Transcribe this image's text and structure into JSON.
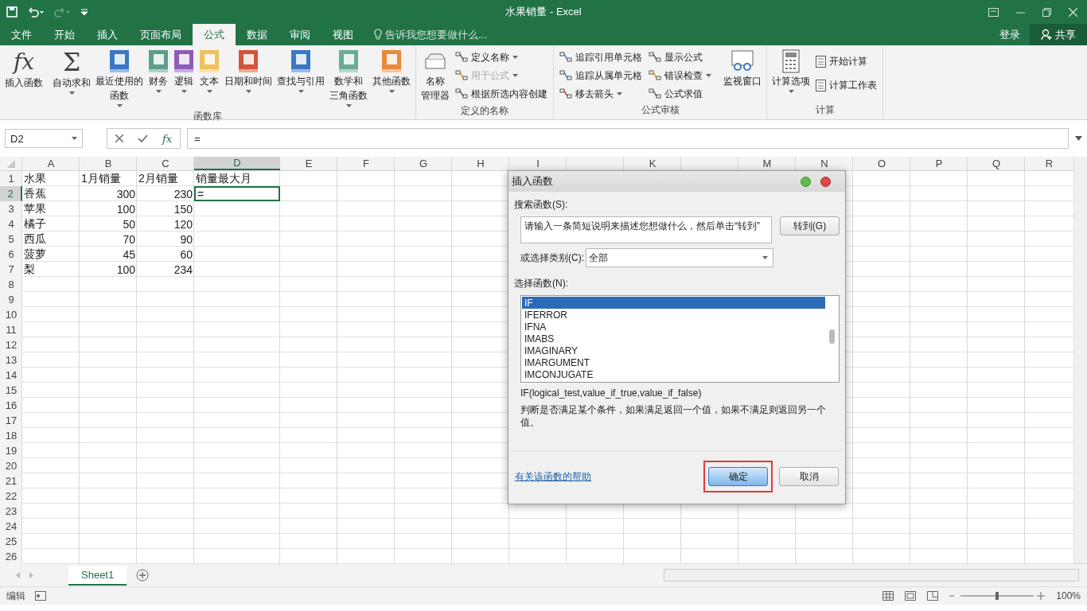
{
  "window": {
    "title": "水果销量 - Excel"
  },
  "ribbon_tabs": [
    {
      "label": "文件",
      "selected": false
    },
    {
      "label": "开始",
      "selected": false
    },
    {
      "label": "插入",
      "selected": false
    },
    {
      "label": "页面布局",
      "selected": false
    },
    {
      "label": "公式",
      "selected": true
    },
    {
      "label": "数据",
      "selected": false
    },
    {
      "label": "审阅",
      "selected": false
    },
    {
      "label": "视图",
      "selected": false
    }
  ],
  "tell_me": {
    "placeholder": "告诉我您想要做什么..."
  },
  "account": {
    "sign_in": "登录",
    "share": "共享"
  },
  "function_library": {
    "label": "函数库",
    "buttons": [
      {
        "kind": "glyph",
        "glyph": "fx",
        "lines": [
          "插入函数"
        ],
        "dropdown": false
      },
      {
        "kind": "glyph",
        "glyph": "Σ",
        "lines": [
          "自动求和"
        ],
        "dropdown": true
      },
      {
        "kind": "book",
        "color": "#3b78c4",
        "lines": [
          "最近使用的",
          "函数"
        ],
        "dropdown": true
      },
      {
        "kind": "book",
        "color": "#5e9e8b",
        "lines": [
          "财务"
        ],
        "dropdown": true
      },
      {
        "kind": "book",
        "color": "#8d5cb8",
        "lines": [
          "逻辑"
        ],
        "dropdown": true
      },
      {
        "kind": "book",
        "color": "#eec15e",
        "lines": [
          "文本"
        ],
        "dropdown": true
      },
      {
        "kind": "book",
        "color": "#d3553a",
        "lines": [
          "日期和时间"
        ],
        "dropdown": true
      },
      {
        "kind": "book",
        "color": "#3b78c4",
        "lines": [
          "查找与引用"
        ],
        "dropdown": true
      },
      {
        "kind": "book",
        "color": "#6aab98",
        "lines": [
          "数学和",
          "三角函数"
        ],
        "dropdown": true
      },
      {
        "kind": "book",
        "color": "#e88a3a",
        "lines": [
          "其他函数"
        ],
        "dropdown": true
      }
    ]
  },
  "defined_names": {
    "label": "定义的名称",
    "big": {
      "lines": [
        "名称",
        "管理器"
      ]
    },
    "items": [
      {
        "label": "定义名称",
        "dropdown": true,
        "disabled": false
      },
      {
        "label": "用于公式",
        "dropdown": true,
        "disabled": true
      },
      {
        "label": "根据所选内容创建",
        "dropdown": false,
        "disabled": false
      }
    ]
  },
  "formula_auditing": {
    "label": "公式审核",
    "items": [
      {
        "label": "追踪引用单元格",
        "dropdown": false
      },
      {
        "label": "追踪从属单元格",
        "dropdown": false
      },
      {
        "label": "移去箭头",
        "dropdown": true
      },
      {
        "label": "显示公式",
        "dropdown": false
      },
      {
        "label": "错误检查",
        "dropdown": true
      },
      {
        "label": "公式求值",
        "dropdown": false
      }
    ],
    "watch": "监视窗口"
  },
  "calculation": {
    "label": "计算",
    "options": "计算选项",
    "items": [
      "开始计算",
      "计算工作表"
    ]
  },
  "formula_bar": {
    "name_box": "D2",
    "fx": "fx",
    "value": "="
  },
  "table": {
    "columns": [
      {
        "label": "A",
        "selected": false,
        "kind": "text"
      },
      {
        "label": "B",
        "selected": false,
        "kind": "number"
      },
      {
        "label": "C",
        "selected": false,
        "kind": "number"
      },
      {
        "label": "D",
        "selected": true,
        "kind": "text"
      },
      {
        "label": "E",
        "selected": false,
        "kind": "text"
      },
      {
        "label": "F",
        "selected": false,
        "kind": "text"
      },
      {
        "label": "G",
        "selected": false,
        "kind": "text"
      },
      {
        "label": "H",
        "selected": false,
        "kind": "text"
      },
      {
        "label": "I",
        "selected": false,
        "kind": "text"
      },
      {
        "kind": "text"
      },
      {
        "label": "K",
        "selected": false,
        "kind": "text"
      },
      {
        "kind": "text"
      },
      {
        "label": "M",
        "selected": false,
        "kind": "text"
      },
      {
        "label": "N",
        "selected": false,
        "kind": "text"
      },
      {
        "label": "O",
        "selected": false,
        "kind": "text"
      },
      {
        "label": "P",
        "selected": false,
        "kind": "text"
      },
      {
        "label": "Q",
        "selected": false,
        "kind": "text"
      },
      {
        "label": "R",
        "selected": false,
        "kind": "text"
      }
    ],
    "rows": [
      {
        "label": "1",
        "selected": false,
        "kind": "header",
        "cells": [
          "水果",
          "1月销量",
          "2月销量",
          "销量最大月"
        ]
      },
      {
        "label": "2",
        "selected": true,
        "kind": "data",
        "cells": [
          "香蕉",
          "300",
          "230",
          "="
        ]
      },
      {
        "label": "3",
        "selected": false,
        "kind": "data",
        "cells": [
          "苹果",
          "100",
          "150"
        ]
      },
      {
        "label": "4",
        "selected": false,
        "kind": "data",
        "cells": [
          "橘子",
          "50",
          "120"
        ]
      },
      {
        "label": "5",
        "selected": false,
        "kind": "data",
        "cells": [
          "西瓜",
          "70",
          "90"
        ]
      },
      {
        "label": "6",
        "selected": false,
        "kind": "data",
        "cells": [
          "菠萝",
          "45",
          "60"
        ]
      },
      {
        "label": "7",
        "selected": false,
        "kind": "data",
        "cells": [
          "梨",
          "100",
          "234"
        ]
      },
      {
        "label": "8",
        "selected": false,
        "kind": "data",
        "cells": []
      },
      {
        "label": "9",
        "selected": false,
        "kind": "data",
        "cells": []
      },
      {
        "label": "10",
        "selected": false,
        "kind": "data",
        "cells": []
      },
      {
        "label": "11",
        "selected": false,
        "kind": "data",
        "cells": []
      },
      {
        "label": "12",
        "selected": false,
        "kind": "data",
        "cells": []
      },
      {
        "label": "13",
        "selected": false,
        "kind": "data",
        "cells": []
      },
      {
        "label": "14",
        "selected": false,
        "kind": "data",
        "cells": []
      },
      {
        "label": "15",
        "selected": false,
        "kind": "data",
        "cells": []
      },
      {
        "label": "16",
        "selected": false,
        "kind": "data",
        "cells": []
      },
      {
        "label": "17",
        "selected": false,
        "kind": "data",
        "cells": []
      },
      {
        "label": "18",
        "selected": false,
        "kind": "data",
        "cells": []
      },
      {
        "label": "19",
        "selected": false,
        "kind": "data",
        "cells": []
      },
      {
        "label": "20",
        "selected": false,
        "kind": "data",
        "cells": []
      },
      {
        "label": "21",
        "selected": false,
        "kind": "data",
        "cells": []
      },
      {
        "label": "22",
        "selected": false,
        "kind": "data",
        "cells": []
      },
      {
        "label": "23",
        "selected": false,
        "kind": "data",
        "cells": []
      },
      {
        "label": "24",
        "selected": false,
        "kind": "data",
        "cells": []
      },
      {
        "label": "25",
        "selected": false,
        "kind": "data",
        "cells": []
      },
      {
        "label": "26",
        "selected": false,
        "kind": "data",
        "cells": []
      }
    ]
  },
  "dialog": {
    "title": "插入函数",
    "search_label": "搜索函数(S):",
    "search_value": "请输入一条简短说明来描述您想做什么，然后单击“转到”",
    "go_button": "转到(G)",
    "category_label": "或选择类别(C):",
    "category_value": "全部",
    "list_label": "选择函数(N):",
    "functions": [
      {
        "label": "IF",
        "selected": true
      },
      {
        "label": "IFERROR",
        "selected": false
      },
      {
        "label": "IFNA",
        "selected": false
      },
      {
        "label": "IMABS",
        "selected": false
      },
      {
        "label": "IMAGINARY",
        "selected": false
      },
      {
        "label": "IMARGUMENT",
        "selected": false
      },
      {
        "label": "IMCONJUGATE",
        "selected": false
      }
    ],
    "signature": "IF(logical_test,value_if_true,value_if_false)",
    "description": "判断是否满足某个条件，如果满足返回一个值，如果不满足则返回另一个值。",
    "help_link": "有关该函数的帮助",
    "ok_button": "确定",
    "cancel_button": "取消"
  },
  "sheet_tabs": [
    {
      "label": "Sheet1",
      "selected": true
    }
  ],
  "status_bar": {
    "mode": "编辑",
    "zoom": "100%",
    "zoom_slider": {
      "level": 0.5
    }
  }
}
